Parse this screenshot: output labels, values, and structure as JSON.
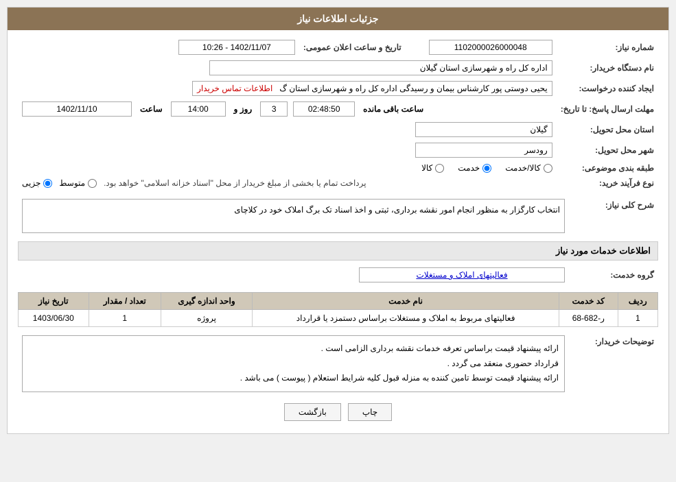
{
  "header": {
    "title": "جزئیات اطلاعات نیاز"
  },
  "fields": {
    "need_number_label": "شماره نیاز:",
    "need_number_value": "1102000026000048",
    "announce_date_label": "تاریخ و ساعت اعلان عمومی:",
    "announce_date_value": "1402/11/07 - 10:26",
    "buyer_org_label": "نام دستگاه خریدار:",
    "buyer_org_value": "اداره کل راه و شهرسازی استان گیلان",
    "creator_label": "ایجاد کننده درخواست:",
    "creator_value": "یحیی دوستی پور کارشناس بیمان و رسیدگی اداره کل راه و شهرسازی استان گ",
    "contact_link": "اطلاعات تماس خریدار",
    "deadline_label": "مهلت ارسال پاسخ: تا تاریخ:",
    "deadline_date": "1402/11/10",
    "deadline_time_label": "ساعت",
    "deadline_time": "14:00",
    "deadline_days_label": "روز و",
    "deadline_days": "3",
    "deadline_remaining_label": "ساعت باقی مانده",
    "deadline_remaining": "02:48:50",
    "province_label": "استان محل تحویل:",
    "province_value": "گیلان",
    "city_label": "شهر محل تحویل:",
    "city_value": "رودسر",
    "category_label": "طبقه بندی موضوعی:",
    "category_options": [
      {
        "label": "کالا",
        "value": "kala",
        "selected": false
      },
      {
        "label": "خدمت",
        "value": "khedmat",
        "selected": true
      },
      {
        "label": "کالا/خدمت",
        "value": "kala_khedmat",
        "selected": false
      }
    ],
    "process_label": "نوع فرآیند خرید:",
    "process_options": [
      {
        "label": "جزیی",
        "value": "jozi",
        "selected": true
      },
      {
        "label": "متوسط",
        "value": "motavaset",
        "selected": false
      }
    ],
    "process_text": "پرداخت تمام یا بخشی از مبلغ خریدار از محل \"اسناد خزانه اسلامی\" خواهد بود.",
    "need_desc_label": "شرح کلی نیاز:",
    "need_desc_value": "انتخاب کارگزار به منظور انجام امور نقشه برداری، ثبتی و اخذ اسناد تک برگ املاک خود در کلاچای",
    "services_section_title": "اطلاعات خدمات مورد نیاز",
    "service_group_label": "گروه خدمت:",
    "service_group_value": "فعالیتهای  املاک و مستغلات",
    "table_headers": {
      "row_num": "ردیف",
      "service_code": "کد خدمت",
      "service_name": "نام خدمت",
      "unit": "واحد اندازه گیری",
      "quantity": "تعداد / مقدار",
      "date": "تاریخ نیاز"
    },
    "table_rows": [
      {
        "row_num": "1",
        "service_code": "ر-682-68",
        "service_name": "فعالیتهای مربوط به املاک و مستغلات براساس دستمزد یا قرارداد",
        "unit": "پروژه",
        "quantity": "1",
        "date": "1403/06/30"
      }
    ],
    "buyer_notes_label": "توضیحات خریدار:",
    "buyer_notes_lines": [
      "ارائه پیشنهاد قیمت براساس تعرفه خدمات نقشه برداری الزامی است .",
      "قرارداد حضوری منعقد می گردد .",
      "ارائه پیشنهاد قیمت توسط تامین کننده به منزله قبول کلیه شرایط استعلام ( پیوست ) می باشد ."
    ]
  },
  "buttons": {
    "print_label": "چاپ",
    "back_label": "بازگشت"
  }
}
